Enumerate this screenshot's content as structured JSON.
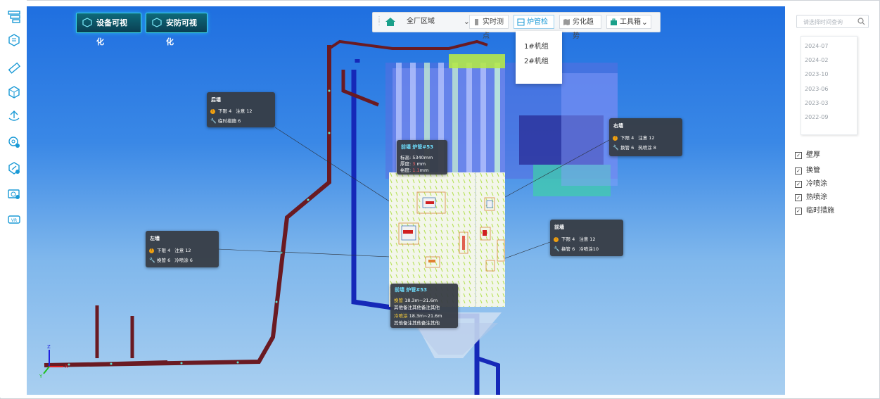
{
  "sidebar": {
    "icons": [
      "hierarchy-icon",
      "layers-icon",
      "ruler-icon",
      "cube-icon",
      "upload-icon",
      "location-gear-icon",
      "settings-shield-icon",
      "camera-settings-icon",
      "vr-icon"
    ],
    "vr_label": "VR"
  },
  "top_buttons": [
    {
      "label": "设备可视化"
    },
    {
      "label": "安防可视化"
    }
  ],
  "toolbar": {
    "area_select": "全厂区域",
    "buttons": [
      {
        "label": "实时测点",
        "icon": "column-icon",
        "active": false
      },
      {
        "label": "炉管检修",
        "icon": "grid-icon",
        "active": true
      },
      {
        "label": "劣化趋势",
        "icon": "map-icon",
        "active": false
      },
      {
        "label": "工具箱",
        "icon": "briefcase-icon",
        "active": false
      }
    ],
    "dropdown": [
      "1#机组",
      "2#机组"
    ]
  },
  "tooltips": {
    "rear": {
      "title": "后墙",
      "row1": "下限 4",
      "row1b": "注意 12",
      "row2": "临时措施 6"
    },
    "right": {
      "title": "右墙",
      "row1": "下限 4",
      "row1b": "注意 12",
      "row2": "换管 6",
      "row2b": "热喷涂 8"
    },
    "left": {
      "title": "左墙",
      "row1": "下限 4",
      "row1b": "注意 12",
      "row2": "换管 6",
      "row2b": "冷喷涂 6"
    },
    "front": {
      "title": "前墙",
      "row1": "下限 4",
      "row1b": "注意 12",
      "row2": "换管 6",
      "row2b": "冷喷涂10"
    },
    "tube_top": {
      "title": "前墙 炉管#53",
      "l1": "标高: 5340mm",
      "l2a": "厚度: ",
      "l2b": "3",
      "l2c": " mm",
      "l3a": "裕度: ",
      "l3b": "1.1",
      "l3c": "mm"
    },
    "tube_bottom": {
      "title": "前墙 炉管#53",
      "l1a": "换管",
      "l1b": " 18.3m~21.6m",
      "l2": "其他备注其他备注其他",
      "l3a": "冷喷涂",
      "l3b": " 18.3m~21.6m",
      "l4": "其他备注其他备注其他"
    }
  },
  "search": {
    "placeholder": "请选择时间查询"
  },
  "dates": [
    "2024-07",
    "2024-02",
    "2023-10",
    "2023-06",
    "2023-03",
    "2022-09"
  ],
  "checks": [
    "壁厚",
    "换管",
    "冷喷涂",
    "热喷涂",
    "临时措施"
  ],
  "axes": {
    "x": "X",
    "y": "Y",
    "z": "Z"
  },
  "colors": {
    "accent": "#1a9ad6",
    "sky_top": "#1f6fe0",
    "pipe": "#6a1a22",
    "tooltip_bg": "#373c44"
  }
}
